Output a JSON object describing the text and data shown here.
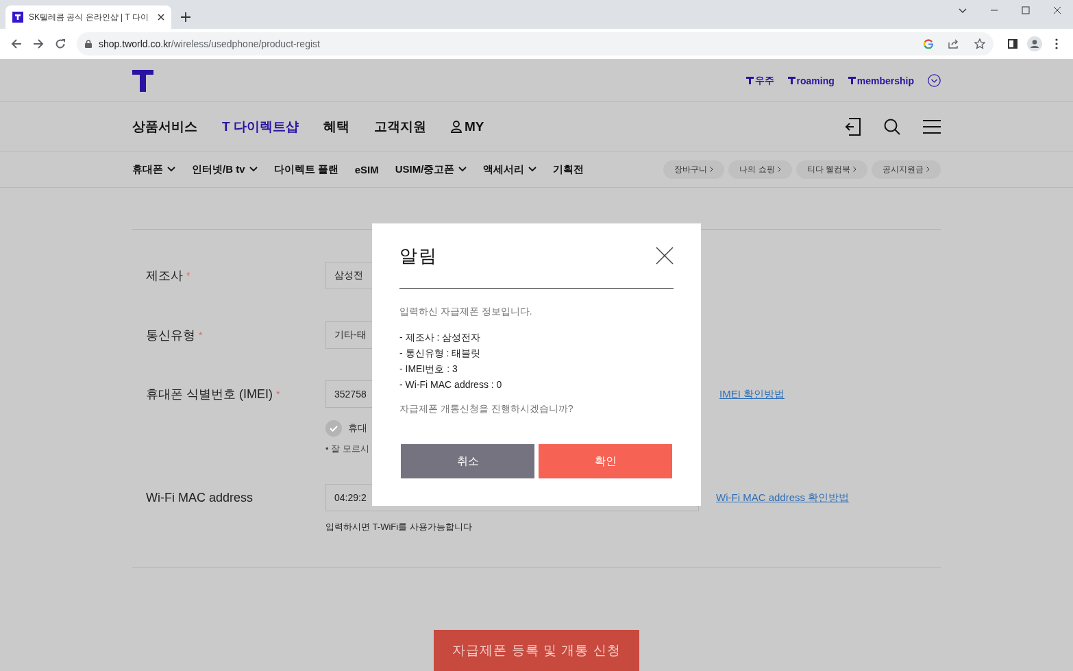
{
  "browser": {
    "tab_title": "SK텔레콤 공식 온라인샵 | T 다이",
    "url_host": "shop.tworld.co.kr",
    "url_path": "/wireless/usedphone/product-regist"
  },
  "top_links": [
    {
      "label": "우주"
    },
    {
      "label": "roaming"
    },
    {
      "label": "membership"
    }
  ],
  "main_nav": [
    {
      "label": "상품서비스",
      "selected": false,
      "kind": "text"
    },
    {
      "label": "T 다이렉트샵",
      "selected": true,
      "kind": "text"
    },
    {
      "label": "혜택",
      "selected": false,
      "kind": "text"
    },
    {
      "label": "고객지원",
      "selected": false,
      "kind": "text"
    },
    {
      "label": "MY",
      "selected": false,
      "kind": "user"
    }
  ],
  "sub_nav": [
    {
      "label": "휴대폰",
      "dropdown": true
    },
    {
      "label": "인터넷/B tv",
      "dropdown": true
    },
    {
      "label": "다이렉트 플랜",
      "dropdown": false
    },
    {
      "label": "eSIM",
      "dropdown": false
    },
    {
      "label": "USIM/중고폰",
      "dropdown": true
    },
    {
      "label": "액세서리",
      "dropdown": true
    },
    {
      "label": "기획전",
      "dropdown": false
    }
  ],
  "chips": [
    {
      "label": "장바구니"
    },
    {
      "label": "나의 쇼핑"
    },
    {
      "label": "티다 웰컴북"
    },
    {
      "label": "공시지원금"
    }
  ],
  "form": {
    "rows": [
      {
        "label": "제조사",
        "required_mark": "*",
        "value": "삼성전"
      },
      {
        "label": "통신유형",
        "required_mark": "*",
        "value": "기타-태"
      },
      {
        "label": "휴대폰 식별번호 (IMEI)",
        "required_mark": "*",
        "value": "352758",
        "link": "IMEI 확인방법",
        "check": {
          "label": "휴대",
          "checked": true
        },
        "note": "• 잘 모르시"
      },
      {
        "label": "Wi-Fi MAC address",
        "value": "04:29:2",
        "link": "Wi-Fi MAC address 확인방법",
        "hint": "입력하시면 T-WiFi를 사용가능합니다"
      }
    ]
  },
  "submit_button": "자급제폰 등록 및 개통 신청",
  "dialog": {
    "title": "알림",
    "intro": "입력하신 자급제폰 정보입니다.",
    "details": [
      "- 제조사 : 삼성전자",
      "- 통신유형 : 태블릿",
      "- IMEI번호 : 3",
      "- Wi-Fi MAC address : 0"
    ],
    "question": "자급제폰 개통신청을 진행하시겠습니까?",
    "buttons": [
      {
        "label": "취소",
        "kind": "cancel"
      },
      {
        "label": "확인",
        "kind": "confirm"
      }
    ]
  }
}
